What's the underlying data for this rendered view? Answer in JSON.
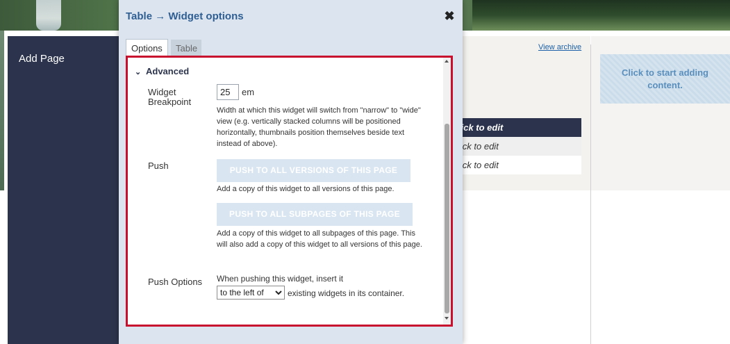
{
  "background": {
    "sidebar_title": "Add Page",
    "view_archive": "View archive",
    "add_content": "Click to start adding content.",
    "table_rows": [
      "lick to edit",
      "lick to edit",
      "lick to edit"
    ]
  },
  "modal": {
    "title": "Table → Widget options",
    "close": "✖",
    "tabs": [
      "Options",
      "Table"
    ],
    "section": "Advanced",
    "breakpoint": {
      "label": "Widget Breakpoint",
      "value": "25",
      "unit": "em",
      "help": "Width at which this widget will switch from \"narrow\" to \"wide\" view (e.g. vertically stacked columns will be positioned horizontally, thumbnails position themselves beside text instead of above)."
    },
    "push": {
      "label": "Push",
      "versions_button": "PUSH TO ALL VERSIONS OF THIS PAGE",
      "versions_help": "Add a copy of this widget to all versions of this page.",
      "subpages_button": "PUSH TO ALL SUBPAGES OF THIS PAGE",
      "subpages_help": "Add a copy of this widget to all subpages of this page. This will also add a copy of this widget to all versions of this page."
    },
    "push_options": {
      "label": "Push Options",
      "intro": "When pushing this widget, insert it",
      "selected": "to the left of",
      "suffix": "existing widgets in its container."
    }
  },
  "colors": {
    "sidebar": "#2c344d",
    "accent_border": "#c8102e",
    "title_blue": "#2f5e93",
    "modal_bg": "#dce5ef"
  }
}
